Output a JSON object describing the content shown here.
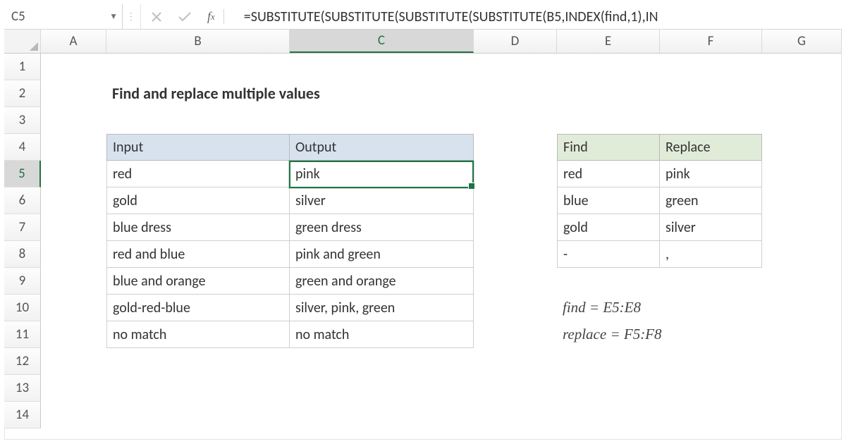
{
  "nameBox": "C5",
  "formula": "=SUBSTITUTE(SUBSTITUTE(SUBSTITUTE(SUBSTITUTE(B5,INDEX(find,1),IN",
  "columns": [
    "A",
    "B",
    "C",
    "D",
    "E",
    "F",
    "G"
  ],
  "rowNumbers": [
    "1",
    "2",
    "3",
    "4",
    "5",
    "6",
    "7",
    "8",
    "9",
    "10",
    "11",
    "12",
    "13",
    "14"
  ],
  "activeCol": "C",
  "activeRow": "5",
  "title": "Find and replace multiple values",
  "mainHeaders": {
    "input": "Input",
    "output": "Output"
  },
  "mainRows": [
    {
      "input": "red",
      "output": "pink"
    },
    {
      "input": "gold",
      "output": "silver"
    },
    {
      "input": "blue dress",
      "output": "green dress"
    },
    {
      "input": "red and blue",
      "output": "pink and green"
    },
    {
      "input": "blue and orange",
      "output": "green and orange"
    },
    {
      "input": "gold-red-blue",
      "output": "silver, pink, green"
    },
    {
      "input": "no match",
      "output": "no match"
    }
  ],
  "frHeaders": {
    "find": "Find",
    "replace": "Replace"
  },
  "frRows": [
    {
      "find": "red",
      "replace": "pink"
    },
    {
      "find": "blue",
      "replace": "green"
    },
    {
      "find": "gold",
      "replace": "silver"
    },
    {
      "find": "-",
      "replace": ","
    }
  ],
  "notes": {
    "line1": "find = E5:E8",
    "line2": "replace = F5:F8"
  }
}
